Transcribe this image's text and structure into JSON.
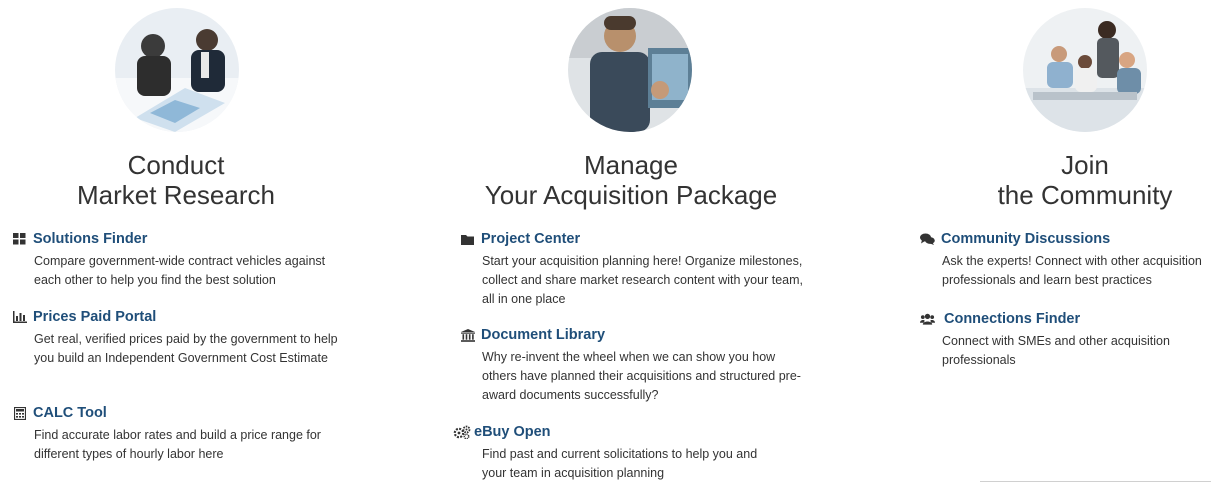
{
  "columns": [
    {
      "heading_line1": "Conduct",
      "heading_line2": "Market Research",
      "items": [
        {
          "icon": "grid-icon",
          "title": "Solutions Finder",
          "desc": "Compare government-wide contract vehicles against each other to help you find the best solution"
        },
        {
          "icon": "bar-chart-icon",
          "title": "Prices Paid Portal",
          "desc": "Get real, verified prices paid by the government to help you build an Independent Government Cost Estimate"
        },
        {
          "icon": "calculator-icon",
          "title": "CALC Tool",
          "desc": "Find accurate labor rates and build a price range for different types of hourly labor here"
        }
      ]
    },
    {
      "heading_line1": "Manage",
      "heading_line2": "Your Acquisition Package",
      "items": [
        {
          "icon": "folder-icon",
          "title": "Project Center",
          "desc": "Start your acquisition planning here! Organize milestones, collect and share market research content with your team, all in one place"
        },
        {
          "icon": "library-icon",
          "title": "Document Library",
          "desc": "Why re-invent the wheel when we can show you how others have planned their acquisitions and structured pre-award documents successfully?"
        },
        {
          "icon": "gears-icon",
          "title": "eBuy Open",
          "desc": "Find past and current solicitations to help you and your team in acquisition planning"
        }
      ]
    },
    {
      "heading_line1": "Join",
      "heading_line2": "the Community",
      "items": [
        {
          "icon": "chat-bubbles-icon",
          "title": "Community Discussions",
          "desc": "Ask the experts! Connect with other acquisition professionals and learn best practices"
        },
        {
          "icon": "users-icon",
          "title": "Connections Finder",
          "desc": "Connect with SMEs and other acquisition professionals"
        }
      ]
    }
  ],
  "colors": {
    "link": "#1f4e79",
    "text": "#333333",
    "heading": "#333333"
  }
}
